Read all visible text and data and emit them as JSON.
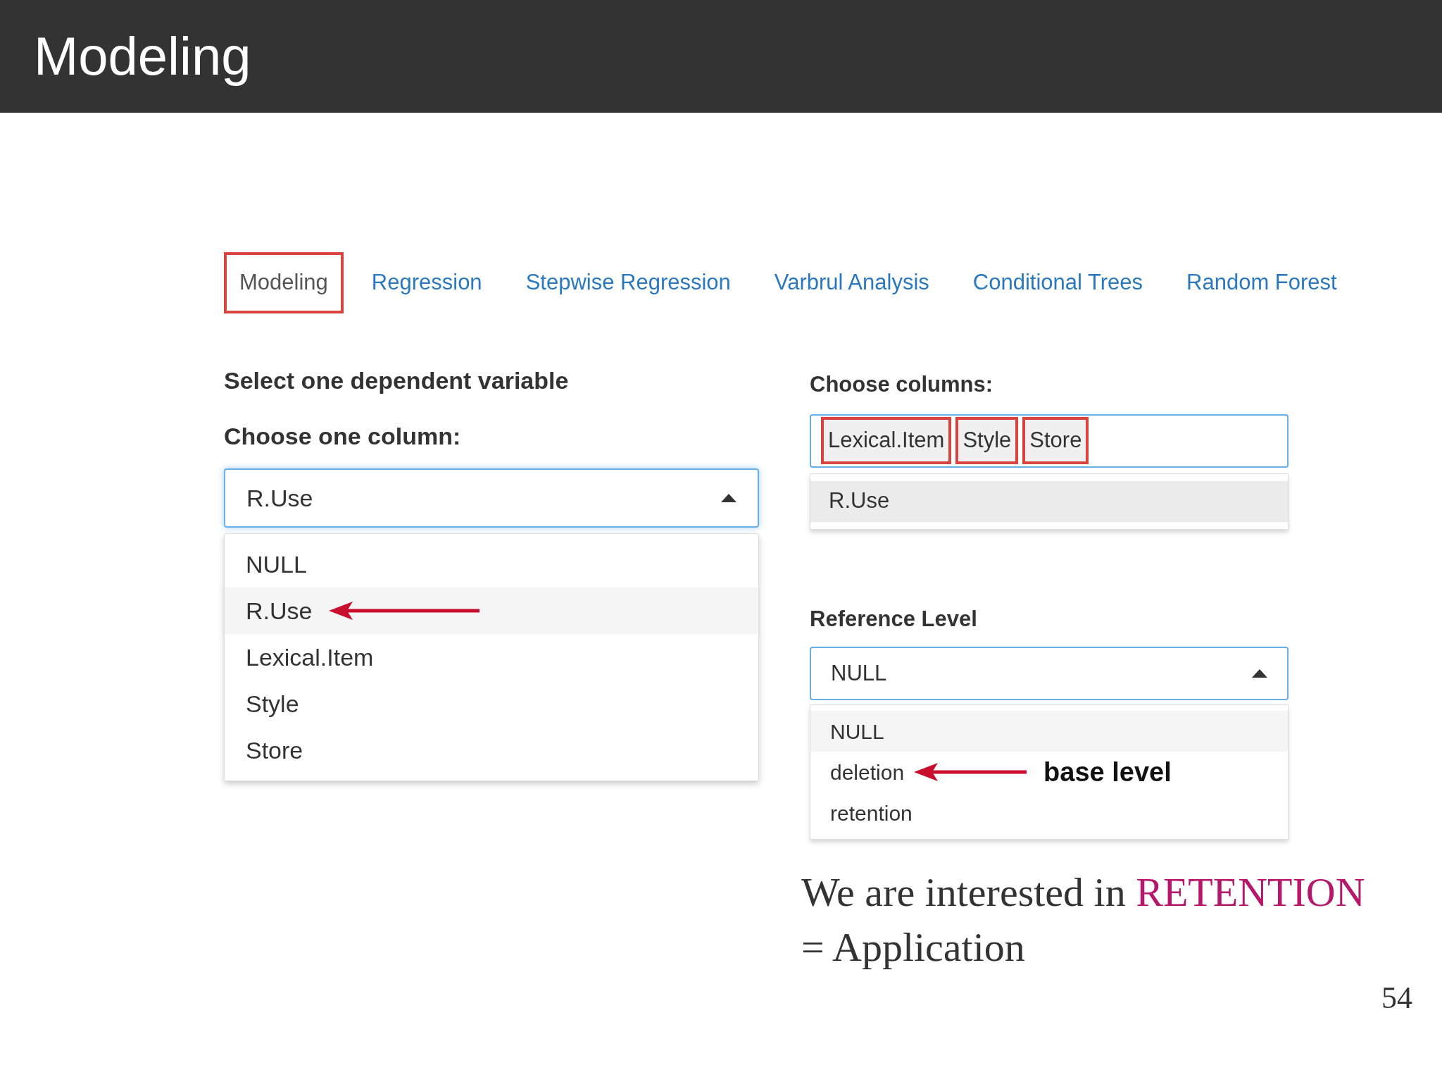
{
  "slide_title": "Modeling",
  "tabs": [
    {
      "label": "Modeling",
      "selected": true,
      "highlighted": true
    },
    {
      "label": "Regression",
      "selected": false,
      "highlighted": false
    },
    {
      "label": "Stepwise Regression",
      "selected": false,
      "highlighted": false
    },
    {
      "label": "Varbrul Analysis",
      "selected": false,
      "highlighted": false
    },
    {
      "label": "Conditional Trees",
      "selected": false,
      "highlighted": false
    },
    {
      "label": "Random Forest",
      "selected": false,
      "highlighted": false
    }
  ],
  "left": {
    "heading": "Select one dependent variable",
    "label": "Choose one column:",
    "select": {
      "value": "R.Use",
      "expanded": true
    },
    "options": [
      {
        "label": "NULL",
        "selected": false,
        "arrow": false
      },
      {
        "label": "R.Use",
        "selected": true,
        "arrow": true
      },
      {
        "label": "Lexical.Item",
        "selected": false,
        "arrow": false
      },
      {
        "label": "Style",
        "selected": false,
        "arrow": false
      },
      {
        "label": "Store",
        "selected": false,
        "arrow": false
      }
    ]
  },
  "right": {
    "columns_label": "Choose columns:",
    "chips": [
      {
        "label": "Lexical.Item",
        "highlighted": true
      },
      {
        "label": "Style",
        "highlighted": true
      },
      {
        "label": "Store",
        "highlighted": true
      }
    ],
    "column_options": [
      {
        "label": "R.Use",
        "selected": true
      }
    ],
    "reference_label": "Reference Level",
    "reference_select": {
      "value": "NULL",
      "expanded": true
    },
    "reference_options": [
      {
        "label": "NULL",
        "selected": true,
        "arrow": false
      },
      {
        "label": "deletion",
        "selected": false,
        "arrow": true,
        "note": "base level"
      },
      {
        "label": "retention",
        "selected": false,
        "arrow": false
      }
    ]
  },
  "caption": {
    "before": "We are interested in",
    "emphasis": "RETENTION",
    "after": "= Application"
  },
  "page_number": "54"
}
